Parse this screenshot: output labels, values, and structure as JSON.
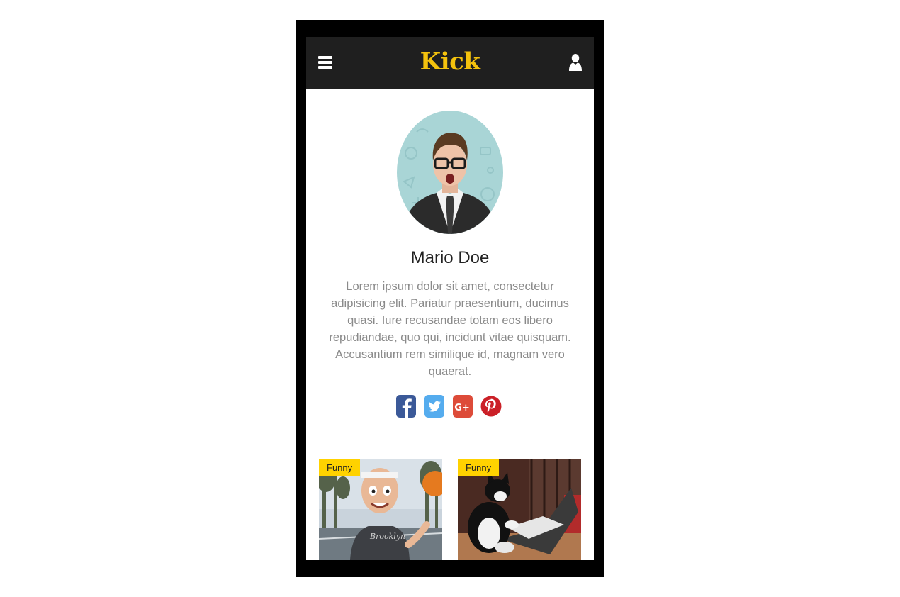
{
  "app": {
    "brand": "Kick"
  },
  "header": {
    "menu_icon": "hamburger-menu-icon",
    "user_icon": "user-icon"
  },
  "profile": {
    "name": "Mario Doe",
    "bio": "Lorem ipsum dolor sit amet, consectetur adipisicing elit. Pariatur praesentium, ducimus quasi. Iure recusandae totam eos libero repudiandae, quo qui, incidunt vitae quisquam. Accusantium rem similique id, magnam vero quaerat."
  },
  "social": [
    {
      "icon": "facebook-icon",
      "color": "#3b5998"
    },
    {
      "icon": "twitter-icon",
      "color": "#55acee"
    },
    {
      "icon": "google-plus-icon",
      "color": "#dd4b39"
    },
    {
      "icon": "pinterest-icon",
      "color": "#cb2027"
    }
  ],
  "posts": [
    {
      "category": "Funny"
    },
    {
      "category": "Funny"
    }
  ],
  "colors": {
    "accent": "#f4c20d",
    "badge": "#ffd200",
    "header_bg": "#1f1f1f"
  }
}
